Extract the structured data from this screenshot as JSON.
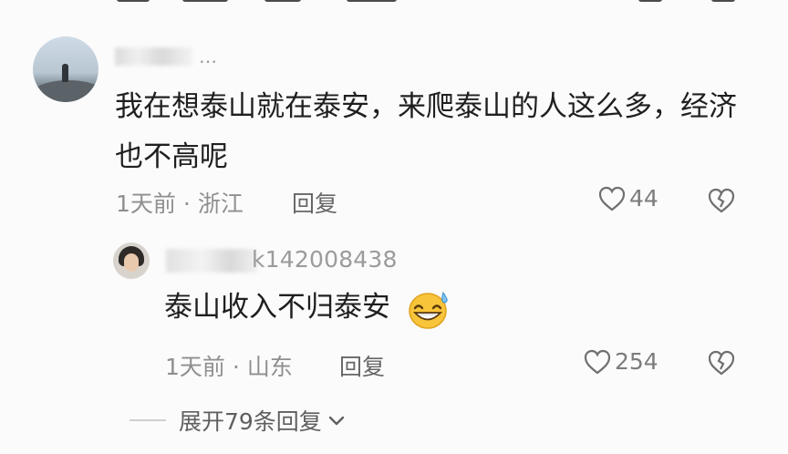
{
  "main_comment": {
    "username_suffix": "…",
    "text": "我在想泰山就在泰安，来爬泰山的人这么多，经济也不高呢",
    "time": "1天前",
    "location": "浙江",
    "separator": "·",
    "reply_label": "回复",
    "likes": "44"
  },
  "reply": {
    "username_visible": "k142008438",
    "text": "泰山收入不归泰安",
    "emoji": "grinning-sweat-emoji",
    "time": "1天前",
    "location": "山东",
    "separator": "·",
    "reply_label": "回复",
    "likes": "254"
  },
  "expand": {
    "label": "展开79条回复"
  },
  "icons": {
    "like": "heart-outline-icon",
    "dislike": "broken-heart-icon",
    "chevron": "chevron-down-icon"
  },
  "colors": {
    "background": "#fbfbfb",
    "text": "#1f1f1f",
    "meta": "#8f8f8f"
  }
}
